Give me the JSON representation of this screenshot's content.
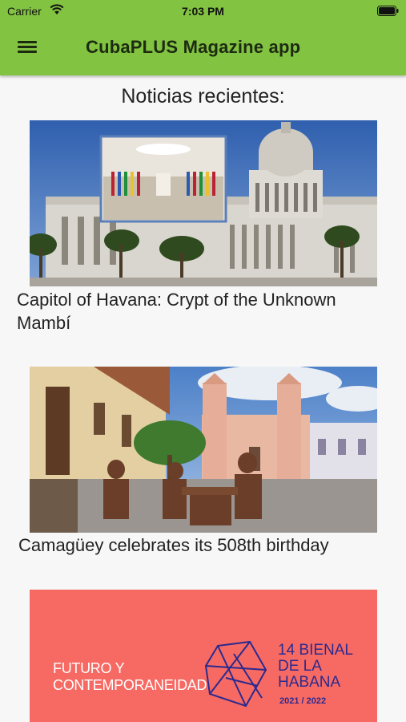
{
  "status_bar": {
    "carrier": "Carrier",
    "time": "7:03 PM"
  },
  "app_bar": {
    "title": "CubaPLUS Magazine app",
    "menu_icon": "hamburger-menu-icon",
    "color": "#82c341"
  },
  "news": {
    "heading": "Noticias recientes:",
    "items": [
      {
        "title": "Capitol of Havana: Crypt of the Unknown Mambí"
      },
      {
        "title": "Camagüey celebrates its 508th birthday"
      },
      {
        "title": "",
        "poster": {
          "left_text_line1": "FUTURO Y",
          "left_text_line2": "CONTEMPORANEIDAD",
          "right_line1": "14 BIENAL",
          "right_line2": "DE LA",
          "right_line3": "HABANA",
          "years": "2021 / 2022",
          "background": "#f76a63"
        }
      }
    ]
  }
}
